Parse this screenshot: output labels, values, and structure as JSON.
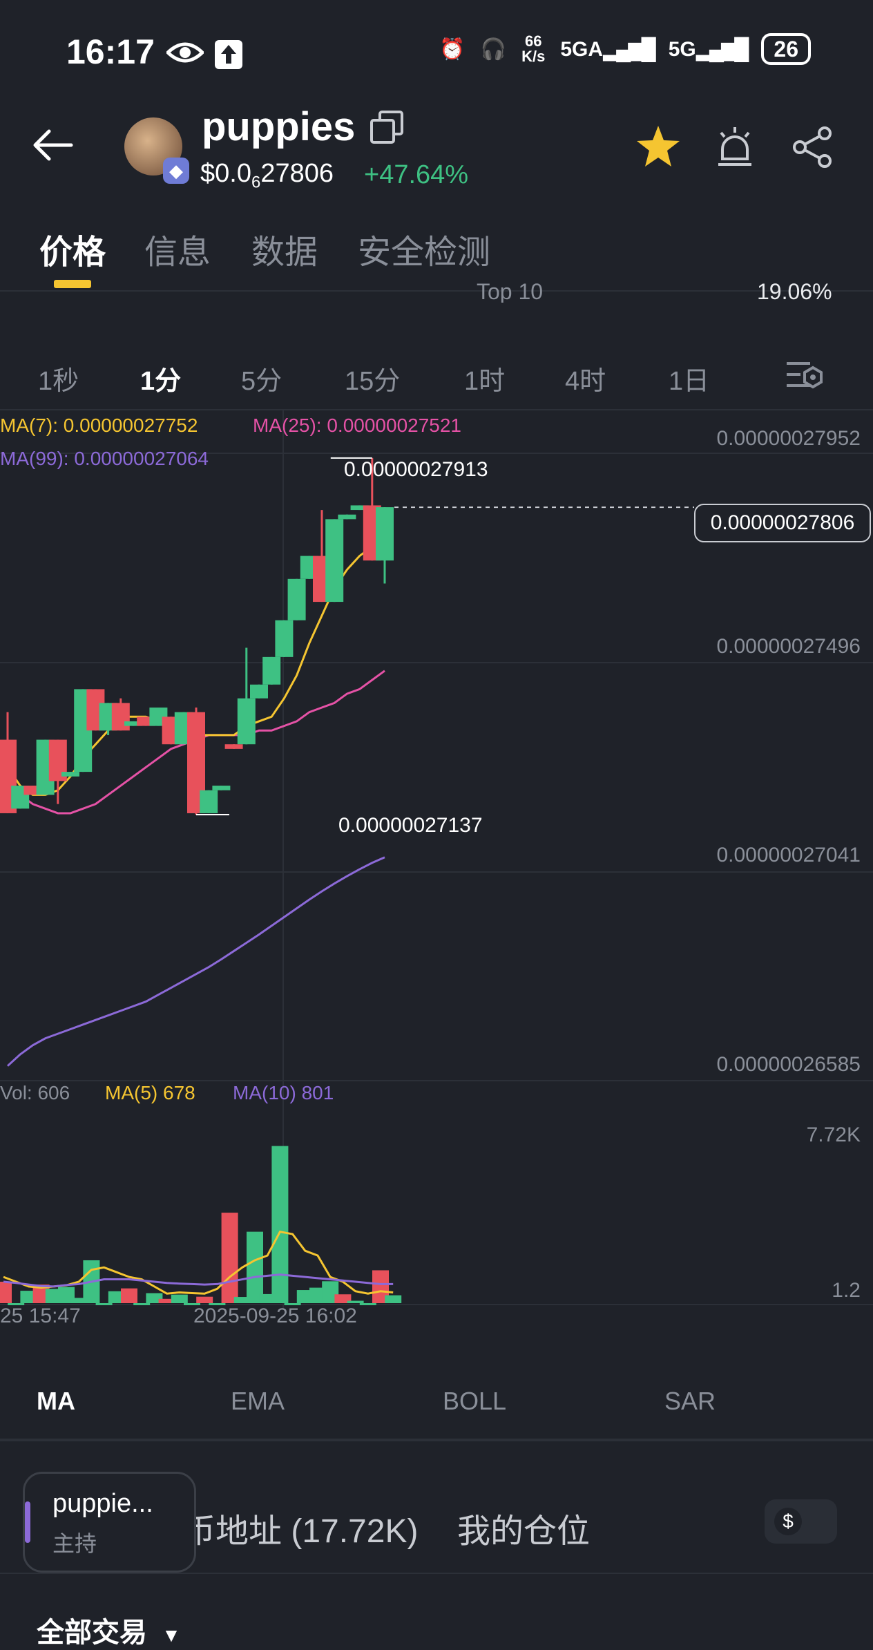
{
  "status_bar": {
    "time": "16:17",
    "speed_top": "66",
    "speed_bottom": "K/s",
    "net1": "5GA",
    "net2": "5G",
    "battery": "26"
  },
  "header": {
    "token_name": "puppies",
    "price_prefix": "$0.0",
    "price_sub": "6",
    "price_rest": "27806",
    "change": "+47.64%"
  },
  "tabs": [
    {
      "label": "价格"
    },
    {
      "label": "信息"
    },
    {
      "label": "数据"
    },
    {
      "label": "安全检测"
    }
  ],
  "hidden_row": {
    "left": "Top 10",
    "right": "19.06%"
  },
  "intervals": [
    "1秒",
    "1分",
    "5分",
    "15分",
    "1时",
    "4时",
    "1日"
  ],
  "ma": {
    "ma7": "MA(7): 0.00000027752",
    "ma25": "MA(25): 0.00000027521",
    "ma99": "MA(99): 0.00000027064"
  },
  "price_axis": [
    "0.00000027952",
    "0.00000027496",
    "0.00000027041",
    "0.00000026585"
  ],
  "high_label": "0.00000027913",
  "low_label": "0.00000027137",
  "current_price_label": "0.00000027806",
  "volume": {
    "vol": "Vol: 606",
    "ma5": "MA(5) 678",
    "ma10": "MA(10) 801",
    "axis_top": "7.72K",
    "axis_bottom": "1.2"
  },
  "time_axis": [
    "25 15:47",
    "2025-09-25 16:02"
  ],
  "indicator_tabs": [
    "MA",
    "EMA",
    "BOLL",
    "SAR"
  ],
  "bottom_tabs": {
    "holders": "币地址 (17.72K)",
    "positions": "我的仓位"
  },
  "token_chip": {
    "name": "puppie...",
    "role": "主持"
  },
  "trades": {
    "label": "全部交易"
  },
  "colors": {
    "up": "#3ec183",
    "down": "#e8515b",
    "accent": "#f5c531",
    "ma7": "#f5c531",
    "ma25": "#e552a6",
    "ma99": "#8c6ad8"
  },
  "chart_data": {
    "type": "candlestick",
    "y_range": [
      2.6585e-07,
      2.7952e-07
    ],
    "candles": [
      {
        "o": 2.73,
        "h": 2.736,
        "l": 2.714,
        "c": 2.714
      },
      {
        "o": 2.715,
        "h": 2.72,
        "l": 2.715,
        "c": 2.72
      },
      {
        "o": 2.72,
        "h": 2.72,
        "l": 2.718,
        "c": 2.718
      },
      {
        "o": 2.718,
        "h": 2.73,
        "l": 2.718,
        "c": 2.73
      },
      {
        "o": 2.73,
        "h": 2.73,
        "l": 2.716,
        "c": 2.721
      },
      {
        "o": 2.722,
        "h": 2.723,
        "l": 2.722,
        "c": 2.723
      },
      {
        "o": 2.723,
        "h": 2.741,
        "l": 2.723,
        "c": 2.741
      },
      {
        "o": 2.741,
        "h": 2.741,
        "l": 2.732,
        "c": 2.732
      },
      {
        "o": 2.732,
        "h": 2.738,
        "l": 2.731,
        "c": 2.738
      },
      {
        "o": 2.738,
        "h": 2.739,
        "l": 2.732,
        "c": 2.732
      },
      {
        "o": 2.733,
        "h": 2.734,
        "l": 2.733,
        "c": 2.734
      },
      {
        "o": 2.735,
        "h": 2.735,
        "l": 2.733,
        "c": 2.733
      },
      {
        "o": 2.733,
        "h": 2.737,
        "l": 2.733,
        "c": 2.737
      },
      {
        "o": 2.735,
        "h": 2.735,
        "l": 2.729,
        "c": 2.729
      },
      {
        "o": 2.729,
        "h": 2.736,
        "l": 2.729,
        "c": 2.736
      },
      {
        "o": 2.736,
        "h": 2.737,
        "l": 2.7137,
        "c": 2.714
      },
      {
        "o": 2.714,
        "h": 2.719,
        "l": 2.714,
        "c": 2.719
      },
      {
        "o": 2.719,
        "h": 2.72,
        "l": 2.719,
        "c": 2.72
      },
      {
        "o": 2.729,
        "h": 2.728,
        "l": 2.729,
        "c": 2.728
      },
      {
        "o": 2.729,
        "h": 2.75,
        "l": 2.729,
        "c": 2.739
      },
      {
        "o": 2.739,
        "h": 2.742,
        "l": 2.739,
        "c": 2.742
      },
      {
        "o": 2.742,
        "h": 2.748,
        "l": 2.742,
        "c": 2.748
      },
      {
        "o": 2.748,
        "h": 2.756,
        "l": 2.748,
        "c": 2.756
      },
      {
        "o": 2.756,
        "h": 2.765,
        "l": 2.756,
        "c": 2.765
      },
      {
        "o": 2.765,
        "h": 2.77,
        "l": 2.765,
        "c": 2.77
      },
      {
        "o": 2.77,
        "h": 2.78,
        "l": 2.76,
        "c": 2.76
      },
      {
        "o": 2.76,
        "h": 2.778,
        "l": 2.76,
        "c": 2.778
      },
      {
        "o": 2.778,
        "h": 2.779,
        "l": 2.778,
        "c": 2.779
      },
      {
        "o": 2.78,
        "h": 2.781,
        "l": 2.78,
        "c": 2.781
      },
      {
        "o": 2.781,
        "h": 2.7913,
        "l": 2.769,
        "c": 2.769
      },
      {
        "o": 2.769,
        "h": 2.7806,
        "l": 2.764,
        "c": 2.7806
      }
    ],
    "ma7": [
      2.724,
      2.72,
      2.718,
      2.718,
      2.719,
      2.722,
      2.726,
      2.729,
      2.732,
      2.735,
      2.735,
      2.735,
      2.734,
      2.734,
      2.733,
      2.731,
      2.731,
      2.731,
      2.731,
      2.733,
      2.734,
      2.735,
      2.739,
      2.744,
      2.751,
      2.757,
      2.763,
      2.767,
      2.77,
      2.772,
      2.775
    ],
    "ma25": [
      2.719,
      2.718,
      2.716,
      2.715,
      2.714,
      2.714,
      2.715,
      2.716,
      2.718,
      2.72,
      2.722,
      2.724,
      2.726,
      2.728,
      2.729,
      2.73,
      2.731,
      2.731,
      2.731,
      2.731,
      2.732,
      2.732,
      2.733,
      2.734,
      2.736,
      2.737,
      2.738,
      2.74,
      2.741,
      2.743,
      2.745
    ],
    "ma99": [
      2.659,
      2.6615,
      2.6635,
      2.665,
      2.666,
      2.667,
      2.668,
      2.669,
      2.67,
      2.671,
      2.672,
      2.673,
      2.6745,
      2.676,
      2.6775,
      2.679,
      2.6805,
      2.6822,
      2.684,
      2.6858,
      2.6876,
      2.6895,
      2.6914,
      2.6933,
      2.6952,
      2.697,
      2.6987,
      2.7003,
      2.7018,
      2.7032,
      2.7044
    ],
    "volumes": [
      900,
      0,
      520,
      780,
      600,
      680,
      220,
      1800,
      0,
      500,
      620,
      0,
      420,
      180,
      360,
      0,
      270,
      0,
      3800,
      260,
      3000,
      380,
      6600,
      0,
      550,
      650,
      920,
      370,
      100,
      0,
      1380,
      330
    ],
    "volume_colors": [
      "down",
      "up",
      "up",
      "down",
      "up",
      "up",
      "up",
      "up",
      "up",
      "up",
      "down",
      "up",
      "up",
      "down",
      "up",
      "up",
      "down",
      "up",
      "down",
      "up",
      "up",
      "up",
      "up",
      "up",
      "up",
      "up",
      "up",
      "down",
      "up",
      "up",
      "down",
      "up"
    ],
    "vol_ma5": [
      1100,
      900,
      700,
      650,
      700,
      750,
      900,
      1400,
      1500,
      1300,
      1100,
      1000,
      700,
      400,
      450,
      420,
      400,
      600,
      1100,
      1500,
      1800,
      2000,
      3000,
      2900,
      2200,
      2000,
      1100,
      900,
      500,
      400,
      500,
      450
    ],
    "vol_ma10": [
      900,
      850,
      780,
      720,
      700,
      760,
      800,
      900,
      1000,
      1000,
      1000,
      950,
      900,
      850,
      820,
      800,
      780,
      800,
      900,
      1000,
      1100,
      1150,
      1200,
      1150,
      1100,
      1050,
      1000,
      950,
      900,
      850,
      800,
      801
    ],
    "vol_range": [
      0,
      7720
    ]
  }
}
